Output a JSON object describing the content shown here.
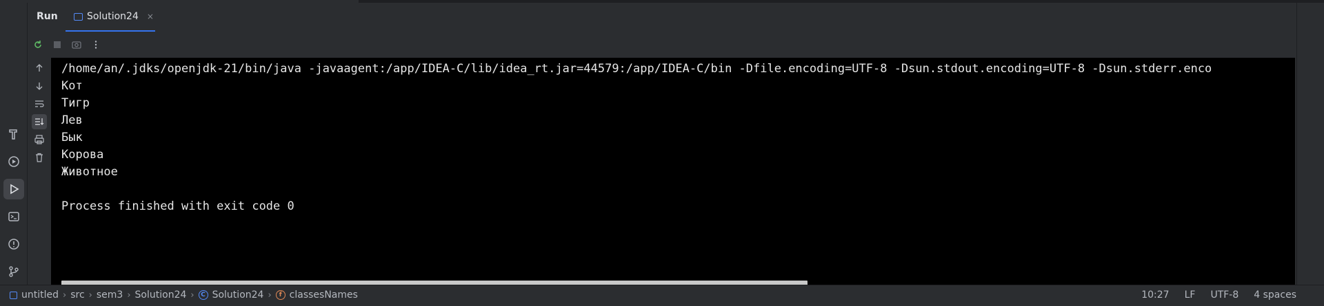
{
  "run_panel": {
    "title": "Run",
    "tab": {
      "label": "Solution24",
      "close": "×"
    }
  },
  "console": {
    "lines": [
      "/home/an/.jdks/openjdk-21/bin/java -javaagent:/app/IDEA-C/lib/idea_rt.jar=44579:/app/IDEA-C/bin -Dfile.encoding=UTF-8 -Dsun.stdout.encoding=UTF-8 -Dsun.stderr.enco",
      "Кот",
      "Тигр",
      "Лев",
      "Бык",
      "Корова",
      "Животное",
      "",
      "Process finished with exit code 0"
    ]
  },
  "breadcrumbs": [
    "untitled",
    "src",
    "sem3",
    "Solution24",
    "Solution24",
    "classesNames"
  ],
  "status": {
    "position": "10:27",
    "line_separator": "LF",
    "encoding": "UTF-8",
    "indent": "4 spaces"
  },
  "icons": {
    "c_icon_letter": "C",
    "f_icon_letter": "f"
  },
  "colors": {
    "accent": "#3574f0",
    "console_bg": "#000000",
    "panel_bg": "#2b2d30"
  }
}
